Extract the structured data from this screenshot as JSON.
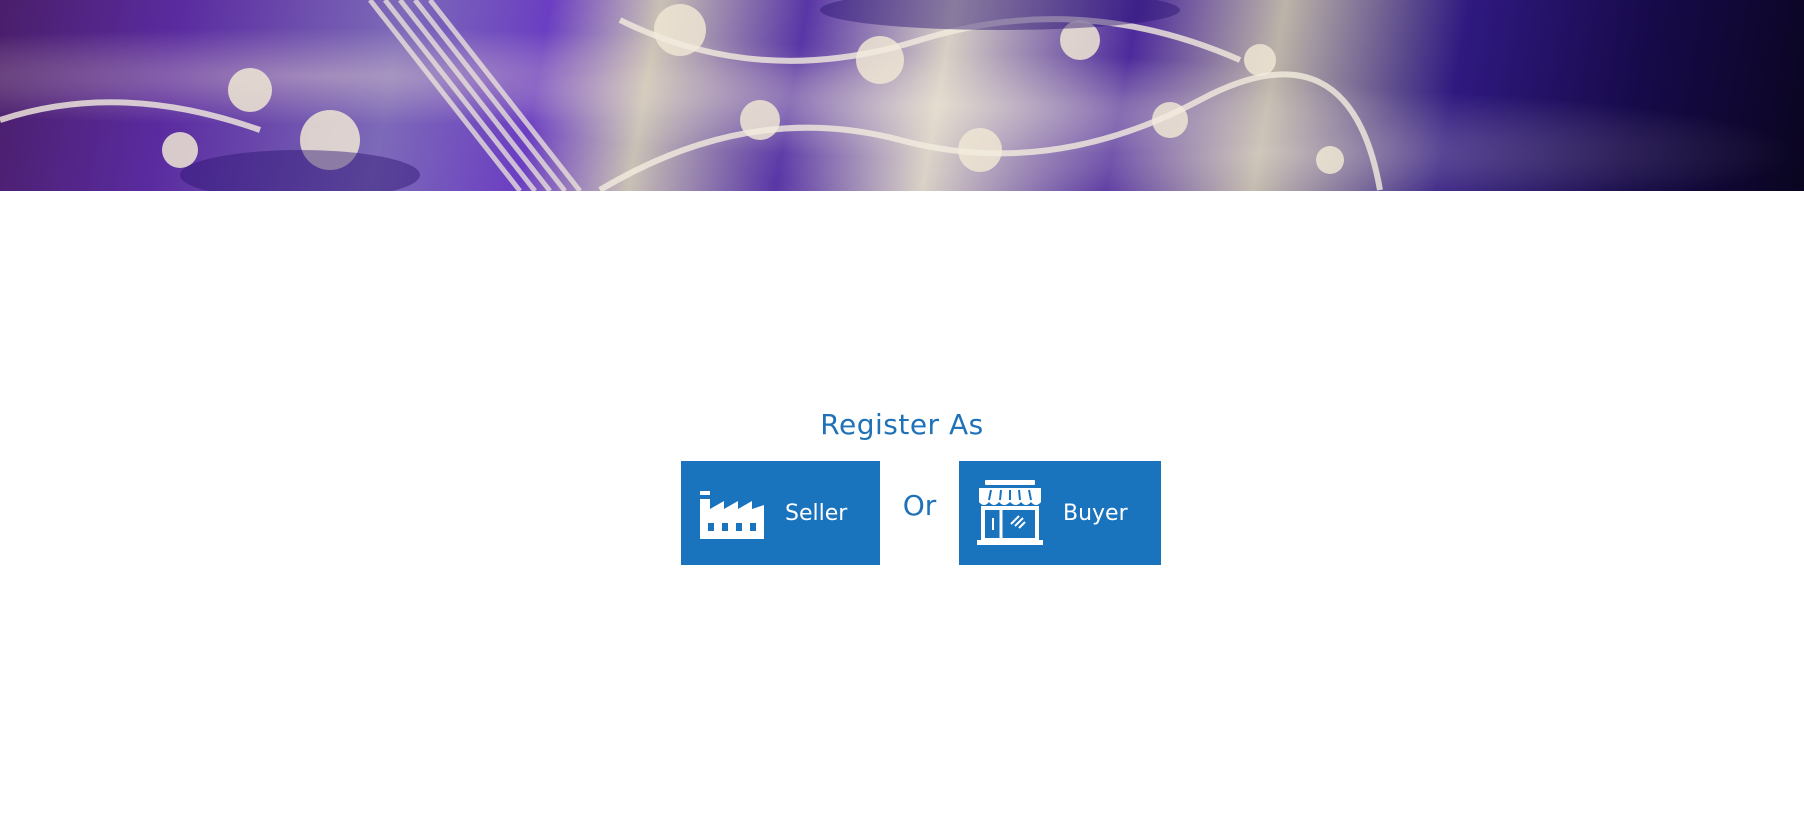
{
  "hero": {
    "image_description": "Purple silk fabric with cream floral brocade pattern"
  },
  "register": {
    "title": "Register As",
    "seller_label": "Seller",
    "separator": "Or",
    "buyer_label": "Buyer",
    "seller_icon": "factory-icon",
    "buyer_icon": "storefront-icon"
  },
  "colors": {
    "accent": "#1a73bd",
    "title_text": "#1f72b8",
    "button_text": "#ffffff"
  }
}
